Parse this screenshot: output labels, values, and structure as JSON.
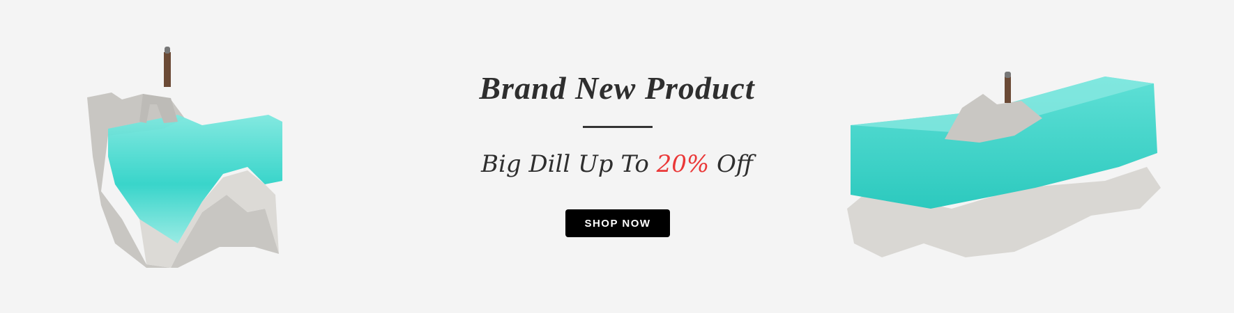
{
  "banner": {
    "title": "Brand New Product",
    "subtitle_prefix": "Big Dill Up To",
    "subtitle_highlight": "20%",
    "subtitle_suffix": "Off",
    "button_label": "SHOP NOW",
    "colors": {
      "background": "#f4f4f4",
      "text": "#2e2e2e",
      "highlight": "#ea3737",
      "button": "#000000",
      "resin": "#3fd9d0"
    }
  }
}
